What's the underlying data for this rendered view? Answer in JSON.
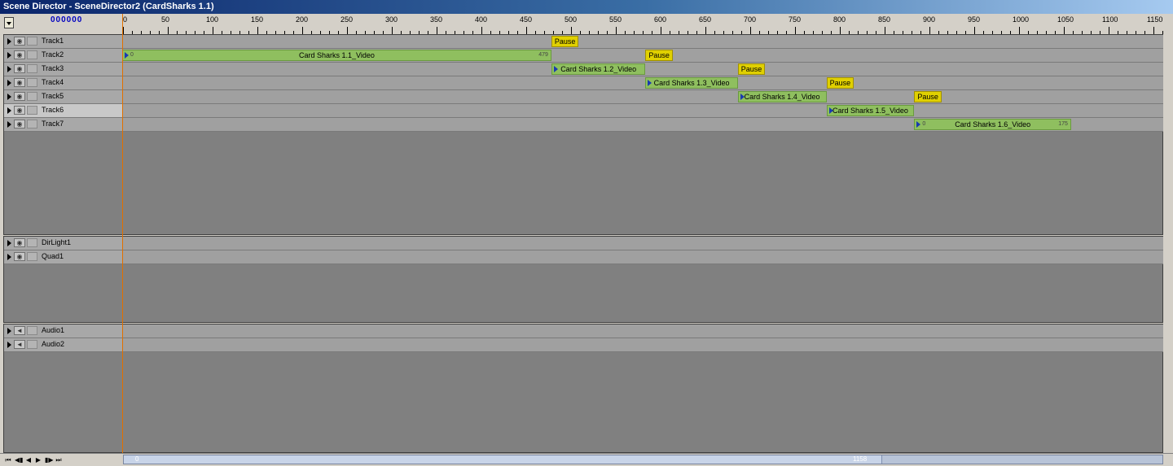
{
  "window": {
    "title": "Scene Director - SceneDirector2 (CardSharks 1.1)"
  },
  "counter": "000000",
  "ruler": {
    "labels": [
      "0",
      "50",
      "100",
      "150",
      "200",
      "250",
      "300",
      "350",
      "400",
      "450",
      "500",
      "550",
      "600",
      "650",
      "700",
      "750",
      "800",
      "850",
      "900",
      "950",
      "1000",
      "1050",
      "1100",
      "1150"
    ]
  },
  "panels": {
    "video": {
      "tracks": [
        "Track1",
        "Track2",
        "Track3",
        "Track4",
        "Track5",
        "Track6",
        "Track7"
      ],
      "selected": "Track6"
    },
    "objects": {
      "tracks": [
        "DirLight1",
        "Quad1"
      ]
    },
    "audio": {
      "tracks": [
        "Audio1",
        "Audio2"
      ]
    }
  },
  "clips": [
    {
      "track": 1,
      "label": "Card Sharks 1.1_Video",
      "start": "0",
      "end": "479"
    },
    {
      "track": 2,
      "label": "Card Sharks 1.2_Video"
    },
    {
      "track": 3,
      "label": "Card Sharks 1.3_Video"
    },
    {
      "track": 4,
      "label": "Card Sharks 1.4_Video"
    },
    {
      "track": 5,
      "label": "Card Sharks 1.5_Video"
    },
    {
      "track": 6,
      "label": "Card Sharks 1.6_Video",
      "start": "0",
      "end": "175"
    }
  ],
  "pauses": [
    {
      "track": 0,
      "label": "Pause"
    },
    {
      "track": 1,
      "label": "Pause"
    },
    {
      "track": 2,
      "label": "Pause"
    },
    {
      "track": 3,
      "label": "Pause"
    },
    {
      "track": 4,
      "label": "Pause"
    }
  ],
  "scrollbar": {
    "start": "0",
    "end": "1158"
  },
  "icons": {
    "track_toggle": "expand-arrow-icon",
    "visibility": "eye-icon",
    "audio": "speaker-icon"
  },
  "colors": {
    "clip": "#8fbf5f",
    "pause": "#e0d000",
    "cursor": "#e07000",
    "title": "#0a246a"
  }
}
